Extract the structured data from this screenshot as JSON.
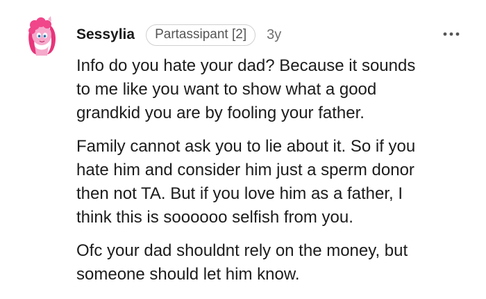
{
  "comment": {
    "author": "Sessylia",
    "flair": "Partassipant [2]",
    "age": "3y",
    "avatar_icon": "pink-pony-avatar-icon",
    "more_icon": "more-options-icon",
    "paragraphs": [
      "Info do you hate your dad? Because it sounds\nto me like you want to show what a good\ngrandkid you are by fooling your father.",
      "Family cannot ask you to lie about it. So if you\nhate him and consider him just a sperm donor\nthen not TA. But if you love him as a father, I\nthink this is soooooo selfish from you.",
      "Ofc your dad shouldnt rely on the money, but\nsomeone should let him know."
    ]
  },
  "colors": {
    "background": "#ffffff",
    "text": "#1c1c1c",
    "muted": "#6f6f6f",
    "flair_border": "#cfcfcf",
    "avatar_pink": "#f0468a"
  }
}
